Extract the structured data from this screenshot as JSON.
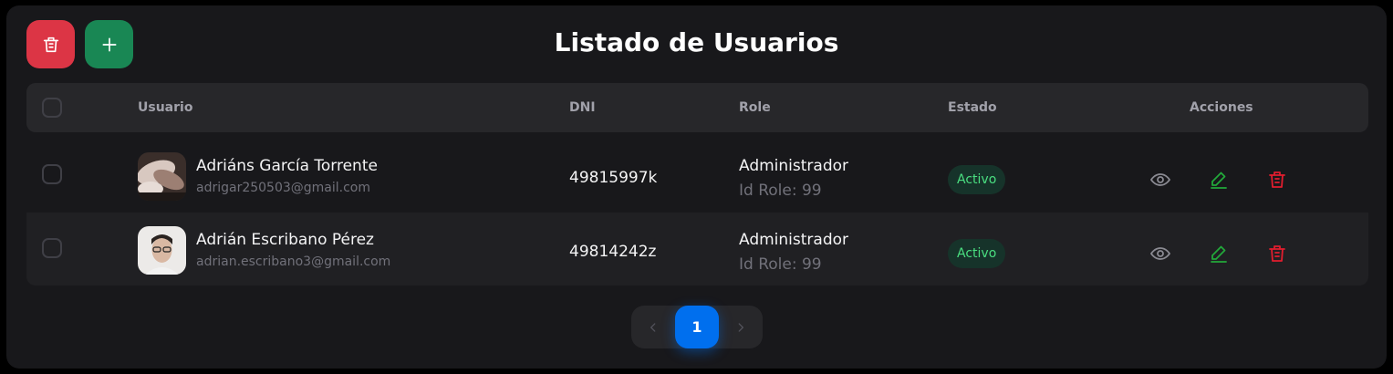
{
  "page": {
    "title": "Listado de Usuarios"
  },
  "toolbar": {
    "delete_icon": "trash-icon",
    "add_icon": "plus-icon"
  },
  "table": {
    "headers": {
      "user": "Usuario",
      "dni": "DNI",
      "role": "Role",
      "status": "Estado",
      "actions": "Acciones"
    },
    "rows": [
      {
        "name": "Adriáns García Torrente",
        "email": "adrigar250503@gmail.com",
        "dni": "49815997k",
        "role": "Administrador",
        "role_id": "Id Role: 99",
        "status": "Activo"
      },
      {
        "name": "Adrián Escribano Pérez",
        "email": "adrian.escribano3@gmail.com",
        "dni": "49814242z",
        "role": "Administrador",
        "role_id": "Id Role: 99",
        "status": "Activo"
      }
    ]
  },
  "pagination": {
    "current": "1",
    "prev_icon": "chevron-left-icon",
    "next_icon": "chevron-right-icon"
  },
  "colors": {
    "danger": "#dc3545",
    "success": "#198754",
    "primary": "#006fee",
    "edit": "#22a83a",
    "delete": "#e11d2e"
  }
}
